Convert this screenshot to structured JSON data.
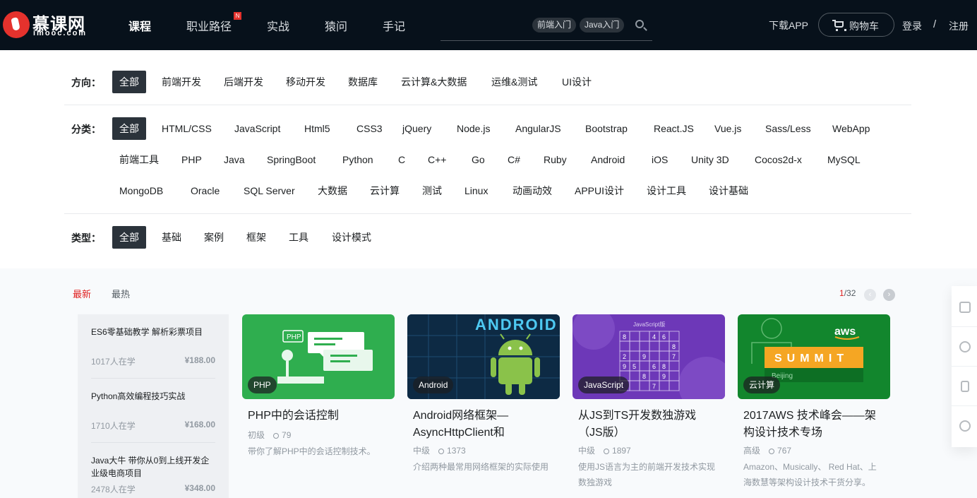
{
  "header": {
    "logo_cn": "慕课网",
    "logo_en": "imooc.com",
    "nav": [
      {
        "label": "课程",
        "active": true
      },
      {
        "label": "职业路径",
        "badge": "N"
      },
      {
        "label": "实战"
      },
      {
        "label": "猿问"
      },
      {
        "label": "手记"
      }
    ],
    "search_tags": [
      "前端入门",
      "Java入门"
    ],
    "download_label": "下载APP",
    "cart_label": "购物车",
    "login_label": "登录",
    "separator": "/",
    "register_label": "注册"
  },
  "filters": {
    "direction": {
      "label": "方向：",
      "items": [
        "全部",
        "前端开发",
        "后端开发",
        "移动开发",
        "数据库",
        "云计算&大数据",
        "运维&测试",
        "UI设计"
      ]
    },
    "category": {
      "label": "分类：",
      "items": [
        "全部",
        "HTML/CSS",
        "JavaScript",
        "Html5",
        "CSS3",
        "jQuery",
        "Node.js",
        "AngularJS",
        "Bootstrap",
        "React.JS",
        "Vue.js",
        "Sass/Less",
        "WebApp",
        "前端工具",
        "PHP",
        "Java",
        "SpringBoot",
        "Python",
        "C",
        "C++",
        "Go",
        "C#",
        "Ruby",
        "Android",
        "iOS",
        "Unity 3D",
        "Cocos2d-x",
        "MySQL",
        "MongoDB",
        "Oracle",
        "SQL Server",
        "大数据",
        "云计算",
        "测试",
        "Linux",
        "动画动效",
        "APPUI设计",
        "设计工具",
        "设计基础"
      ]
    },
    "type": {
      "label": "类型：",
      "items": [
        "全部",
        "基础",
        "案例",
        "框架",
        "工具",
        "设计模式"
      ]
    }
  },
  "sort": {
    "newest": "最新",
    "hottest": "最热"
  },
  "pager": {
    "current": "1",
    "total": "/32"
  },
  "sidebar": [
    {
      "title": "ES6零基础教学 解析彩票项目",
      "learners": "1017人在学",
      "price": "¥188.00"
    },
    {
      "title": "Python高效编程技巧实战",
      "learners": "1710人在学",
      "price": "¥168.00"
    },
    {
      "title": "Java大牛 带你从0到上线开发企业级电商项目",
      "learners": "2478人在学",
      "price": "¥348.00"
    }
  ],
  "cards": [
    {
      "badge": "PHP",
      "title": "PHP中的会话控制",
      "level": "初级",
      "learners": "79",
      "desc": "带你了解PHP中的会话控制技术。",
      "thumb_color": "#2fae4f",
      "thumb_text": "PHP"
    },
    {
      "badge": "Android",
      "title": "Android网络框架—AsyncHttpClient和",
      "level": "中级",
      "learners": "1373",
      "desc": "介绍两种最常用网络框架的实际使用",
      "thumb_color": "#0f2f4c",
      "thumb_text": "ANDROID"
    },
    {
      "badge": "JavaScript",
      "title": "从JS到TS开发数独游戏（JS版）",
      "level": "中级",
      "learners": "1897",
      "desc": "使用JS语言为主的前端开发技术实现数独游戏",
      "thumb_color": "#6d38b8",
      "thumb_text": "JavaScript版"
    },
    {
      "badge": "云计算",
      "title": "2017AWS 技术峰会——架构设计技术专场",
      "level": "高级",
      "learners": "767",
      "desc": "Amazon、Musically、 Red Hat、上海数慧等架构设计技术干货分享。",
      "thumb_color": "#12862d",
      "thumb_text": "SUMMIT",
      "thumb_text2": "aws",
      "thumb_text3": "Beijing"
    }
  ],
  "sudoku": [
    "8",
    "",
    "",
    "4",
    "6",
    "",
    "",
    "",
    "",
    "",
    "",
    "8",
    "2",
    "",
    "9",
    "",
    "",
    "7",
    "9",
    "5",
    "",
    "6",
    "8",
    "",
    "",
    "",
    "8",
    "",
    "9",
    "",
    "",
    "",
    "",
    "7",
    "",
    ""
  ]
}
